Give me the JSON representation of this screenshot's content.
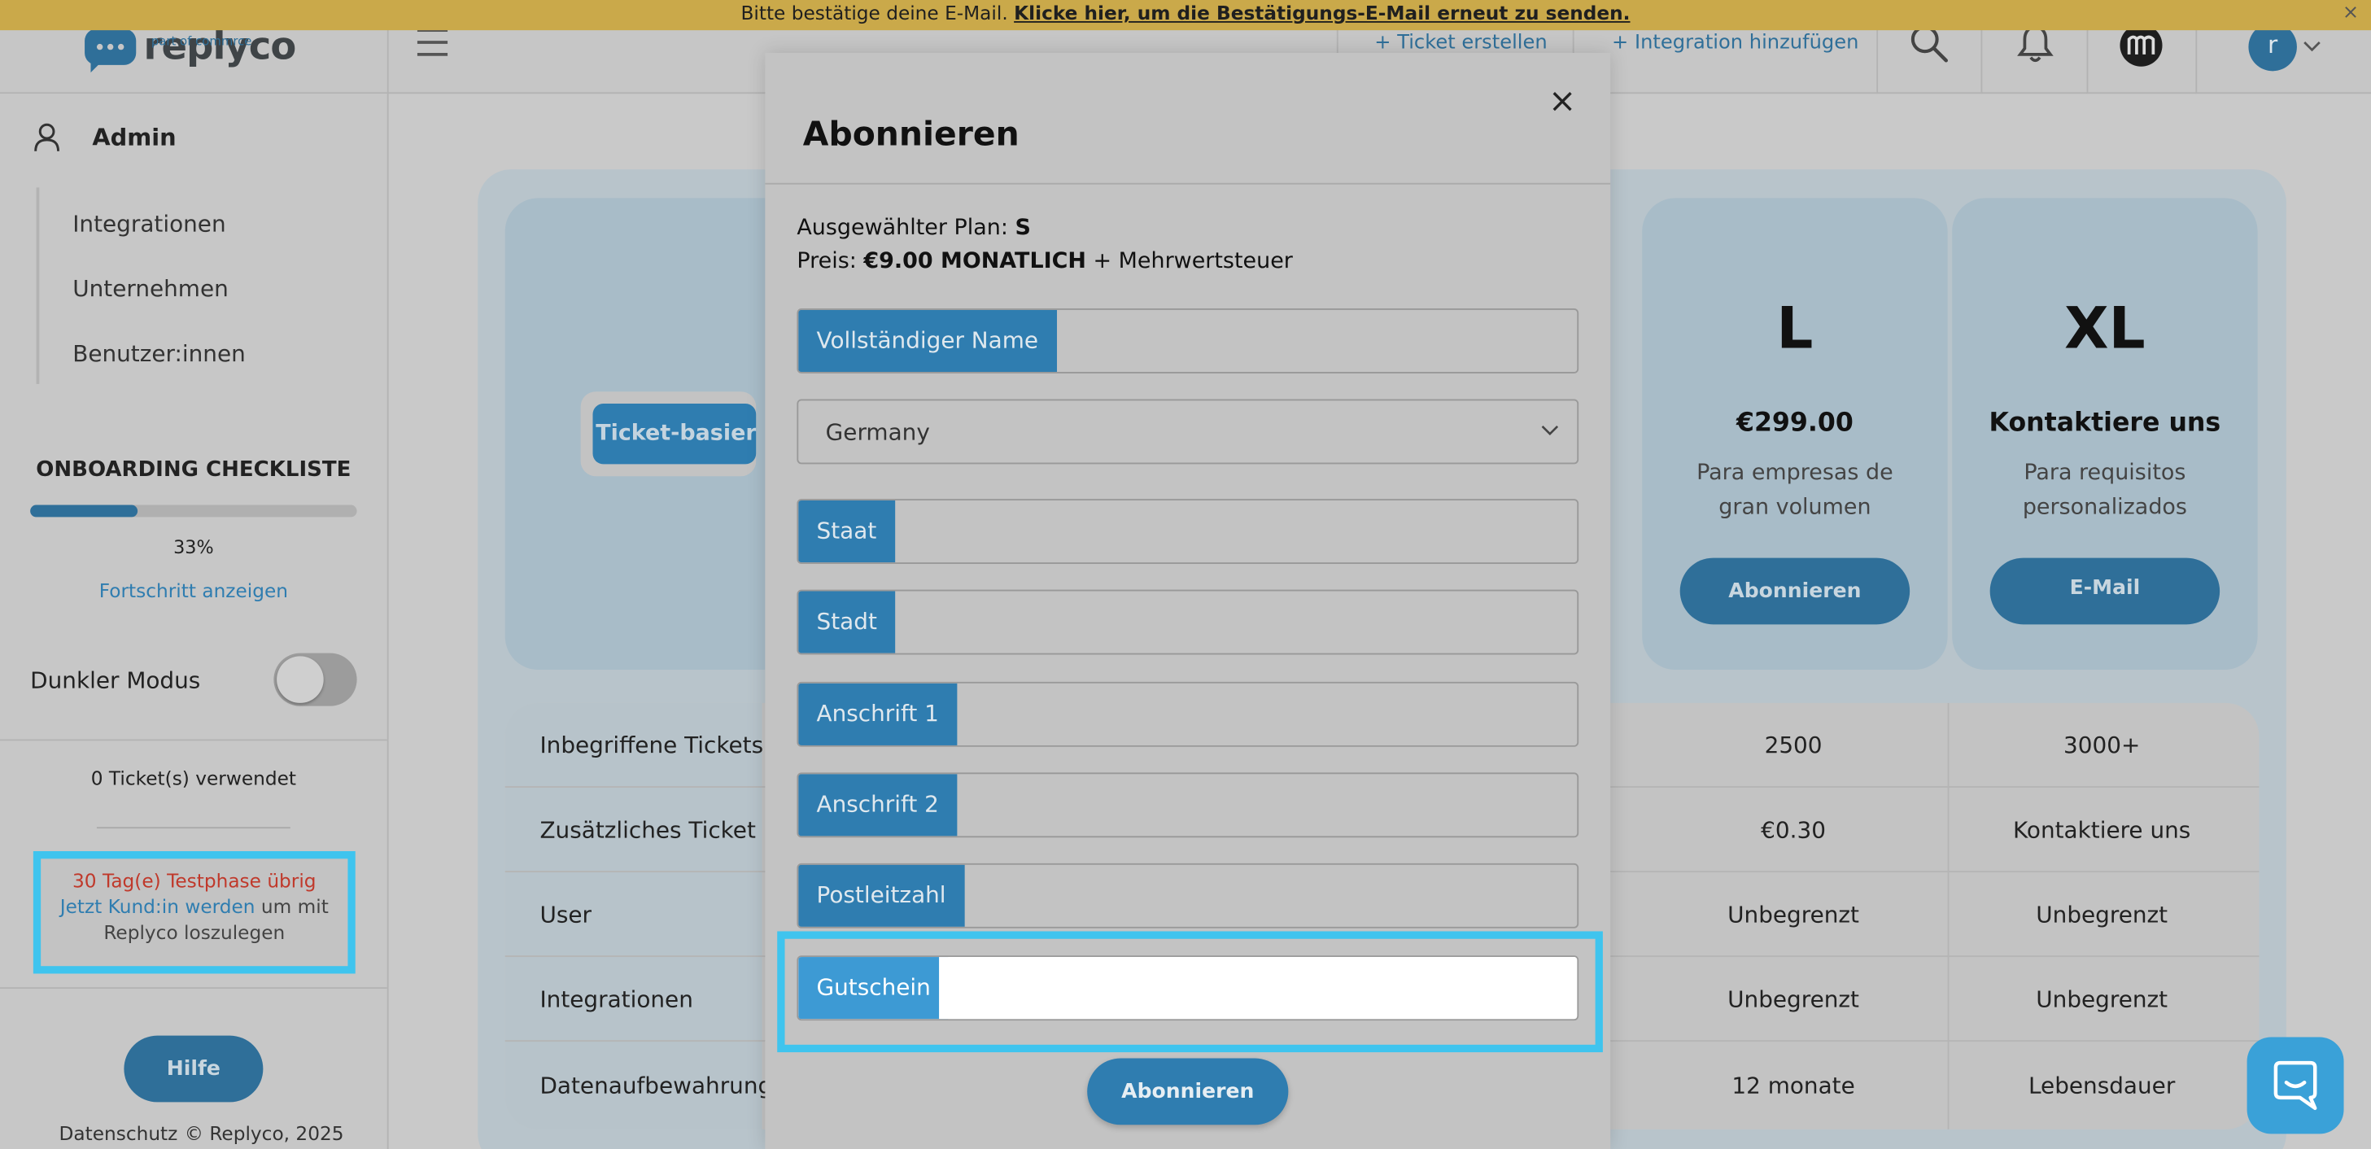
{
  "banner": {
    "text": "Bitte bestätige deine E-Mail.",
    "link": "Klicke hier, um die Bestätigungs-E-Mail erneut zu senden.",
    "close": "×"
  },
  "header": {
    "logo_text": "replyco",
    "logo_sub": "part of commrce",
    "create_ticket": "+ Ticket erstellen",
    "add_integration": "+ Integration hinzufügen",
    "avatar_initial": "r"
  },
  "sidebar": {
    "admin": "Admin",
    "items": [
      {
        "label": "Integrationen"
      },
      {
        "label": "Unternehmen"
      },
      {
        "label": "Benutzer:innen"
      }
    ],
    "onboarding_title": "ONBOARDING CHECKLISTE",
    "progress_percent": 33,
    "progress_label": "33%",
    "progress_link": "Fortschritt anzeigen",
    "dark_mode_label": "Dunkler Modus",
    "tickets_used": "0 Ticket(s) verwendet",
    "trial_text": "30 Tag(e) Testphase übrig",
    "trial_link": "Jetzt Kund:in werden",
    "trial_rest_1": "um mit",
    "trial_rest_2": "Replyco loszulegen",
    "help_button": "Hilfe",
    "footer_privacy": "Datenschutz",
    "footer_copyright": "© Replyco, 2025"
  },
  "pricing": {
    "ticket_based_tab": "Ticket-basierte",
    "plans": [
      {
        "name": "L",
        "price": "€299.00",
        "desc_1": "Para empresas de",
        "desc_2": "gran volumen",
        "button": "Abonnieren"
      },
      {
        "name": "XL",
        "price": "Kontaktiere uns",
        "desc_1": "Para requisitos",
        "desc_2": "personalizados",
        "button": "E-Mail"
      }
    ],
    "feature_rows": [
      {
        "label": "Inbegriffene Tickets",
        "l": "2500",
        "xl": "3000+"
      },
      {
        "label": "Zusätzliches Ticket",
        "l": "€0.30",
        "xl": "Kontaktiere uns"
      },
      {
        "label": "User",
        "l": "Unbegrenzt",
        "xl": "Unbegrenzt"
      },
      {
        "label": "Integrationen",
        "l": "Unbegrenzt",
        "xl": "Unbegrenzt"
      },
      {
        "label": "Datenaufbewahrung",
        "l": "12 monate",
        "xl": "Lebensdauer"
      }
    ]
  },
  "modal": {
    "title": "Abonnieren",
    "close": "×",
    "selected_plan_label": "Ausgewählter Plan:",
    "selected_plan_value": "S",
    "price_label": "Preis:",
    "price_value": "€9.00 MONATLICH",
    "price_suffix": "+ Mehrwertsteuer",
    "fields": {
      "full_name": "Vollständiger Name",
      "state": "Staat",
      "city": "Stadt",
      "address1": "Anschrift 1",
      "address2": "Anschrift 2",
      "postcode": "Postleitzahl",
      "coupon": "Gutschein"
    },
    "country_value": "Germany",
    "submit": "Abonnieren"
  },
  "colors": {
    "accent": "#2f7db0",
    "highlight": "#3fc4ee",
    "trial_red": "#c0392b"
  }
}
